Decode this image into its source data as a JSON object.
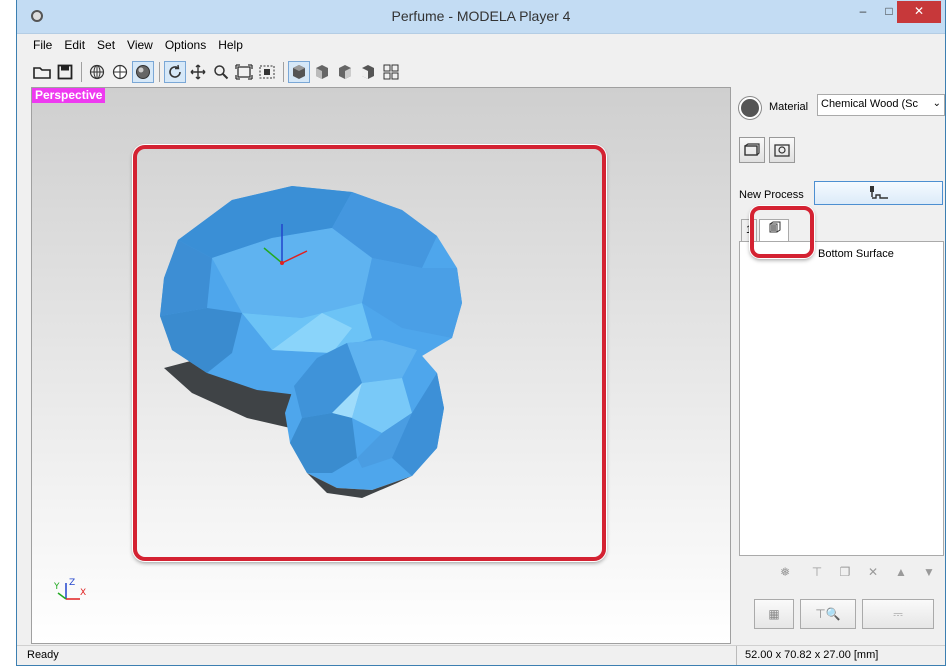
{
  "window": {
    "title": "Perfume - MODELA Player 4",
    "minimize_glyph": "–",
    "maximize_glyph": "□",
    "close_glyph": "✕"
  },
  "menu": [
    "File",
    "Edit",
    "Set",
    "View",
    "Options",
    "Help"
  ],
  "viewport": {
    "view_label": "Perspective",
    "label_color": "#ee3af0",
    "highlight_color": "#d42232",
    "model_color": "#4ea6ec"
  },
  "axis_triad": {
    "x": "X",
    "y": "Y",
    "z": "Z"
  },
  "panel": {
    "material_label": "Material",
    "material_value": "Chemical Wood (Sc",
    "new_process_label": "New Process",
    "tab_a_label": "1",
    "process_item": "Bottom Surface"
  },
  "status": {
    "text": "Ready",
    "dimensions": "52.00 x 70.82 x 27.00 [mm]"
  }
}
